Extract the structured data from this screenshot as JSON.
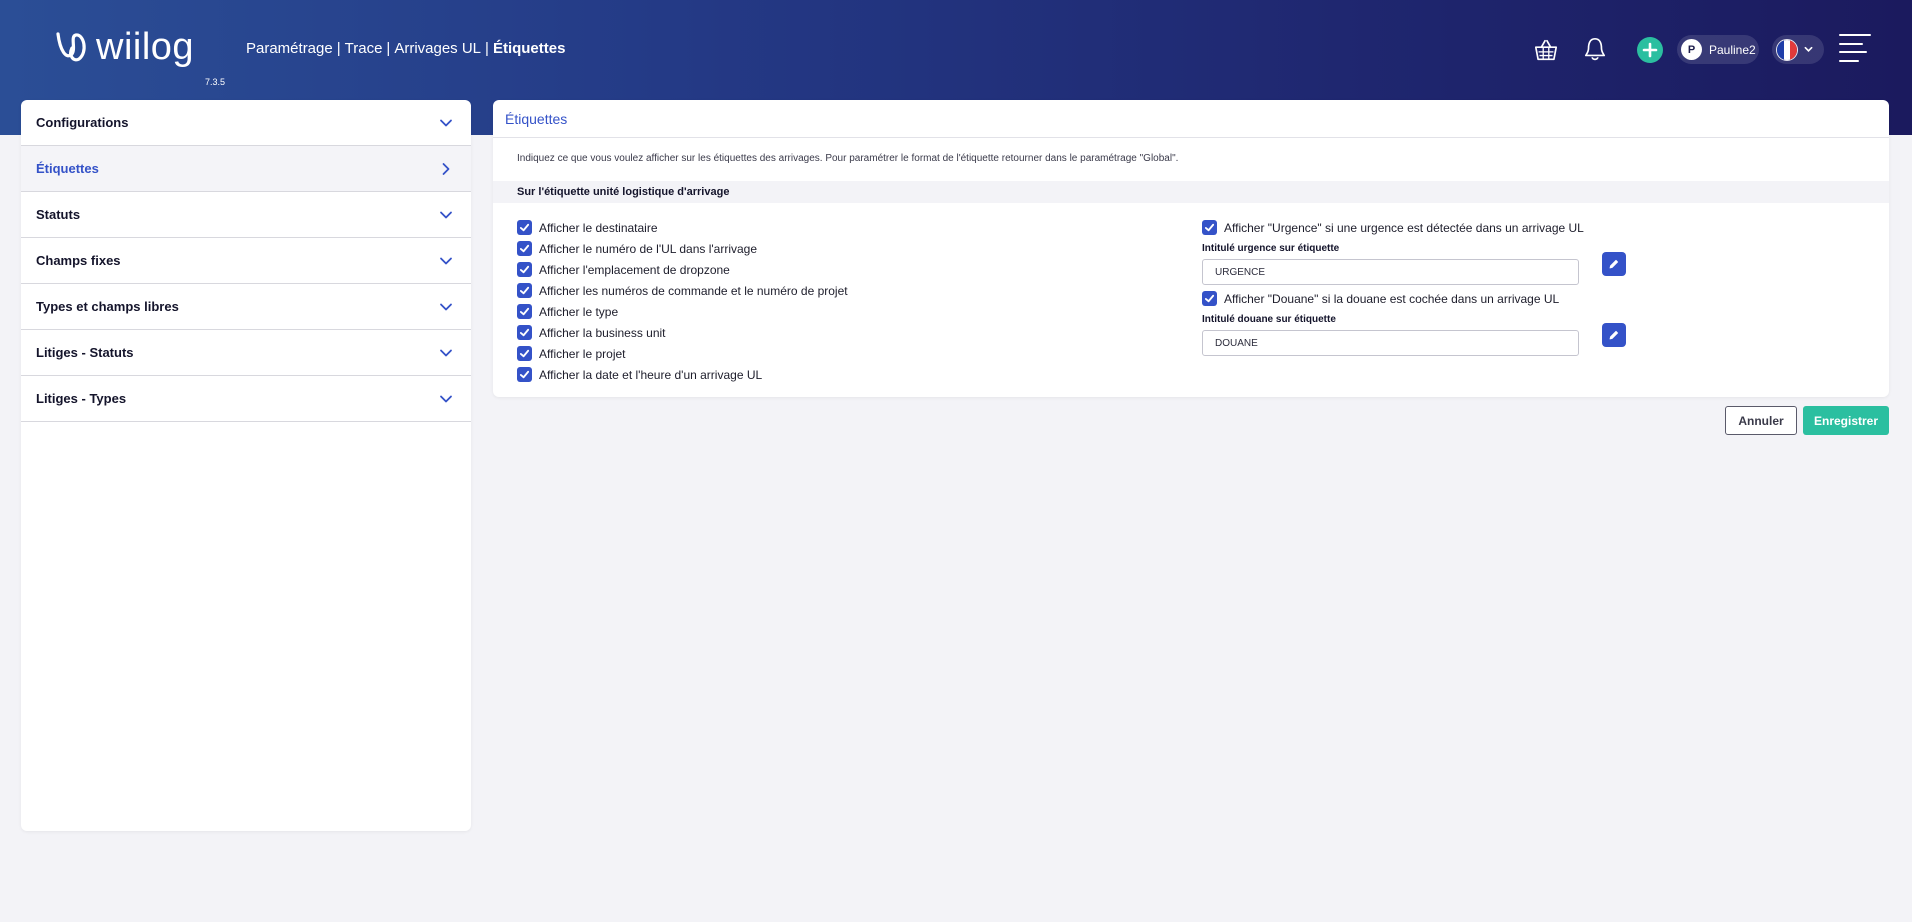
{
  "header": {
    "logo_text": "wiilog",
    "version": "7.3.5",
    "breadcrumb": {
      "items": [
        "Paramétrage",
        "|",
        "Trace",
        "|",
        "Arrivages UL",
        "|"
      ],
      "current": "Étiquettes"
    },
    "icons": [
      "basket-icon",
      "bell-icon",
      "plus-icon",
      "hamburger-menu-icon"
    ],
    "user": {
      "initial": "P",
      "name": "Pauline2"
    },
    "language": {
      "flag": "fr-flag",
      "colors": [
        "#1f3da8",
        "#ffffff",
        "#e23a3a"
      ]
    },
    "accent": "#2bbfa0"
  },
  "sidebar": {
    "items": [
      {
        "label": "Configurations",
        "state": "collapsed"
      },
      {
        "label": "Étiquettes",
        "state": "active"
      },
      {
        "label": "Statuts",
        "state": "collapsed"
      },
      {
        "label": "Champs fixes",
        "state": "collapsed"
      },
      {
        "label": "Types et champs libres",
        "state": "collapsed"
      },
      {
        "label": "Litiges - Statuts",
        "state": "collapsed"
      },
      {
        "label": "Litiges - Types",
        "state": "collapsed"
      }
    ]
  },
  "panel": {
    "title": "Étiquettes",
    "description": "Indiquez ce que vous voulez afficher sur les étiquettes des arrivages. Pour paramétrer le format de l'étiquette retourner dans le paramétrage \"Global\".",
    "section_title": "Sur l'étiquette unité logistique d'arrivage",
    "left_checkboxes": [
      {
        "label": "Afficher le destinataire",
        "checked": true
      },
      {
        "label": "Afficher le numéro de l'UL dans l'arrivage",
        "checked": true
      },
      {
        "label": "Afficher l'emplacement de dropzone",
        "checked": true
      },
      {
        "label": "Afficher les numéros de commande et le numéro de projet",
        "checked": true
      },
      {
        "label": "Afficher le type",
        "checked": true
      },
      {
        "label": "Afficher la business unit",
        "checked": true
      },
      {
        "label": "Afficher le projet",
        "checked": true
      },
      {
        "label": "Afficher la date et l'heure d'un arrivage UL",
        "checked": true
      }
    ],
    "urgence": {
      "checkbox_label": "Afficher \"Urgence\" si une urgence est détectée dans un arrivage UL",
      "checked": true,
      "field_label": "Intitulé urgence sur étiquette",
      "field_value": "URGENCE"
    },
    "douane": {
      "checkbox_label": "Afficher \"Douane\" si la douane est cochée dans un arrivage UL",
      "checked": true,
      "field_label": "Intitulé douane sur étiquette",
      "field_value": "DOUANE"
    }
  },
  "actions": {
    "cancel_label": "Annuler",
    "save_label": "Enregistrer"
  },
  "colors": {
    "primary": "#3452c8",
    "success": "#2bbfa0",
    "header_gradient": [
      "#2b4e96",
      "#1b1a5e"
    ]
  }
}
